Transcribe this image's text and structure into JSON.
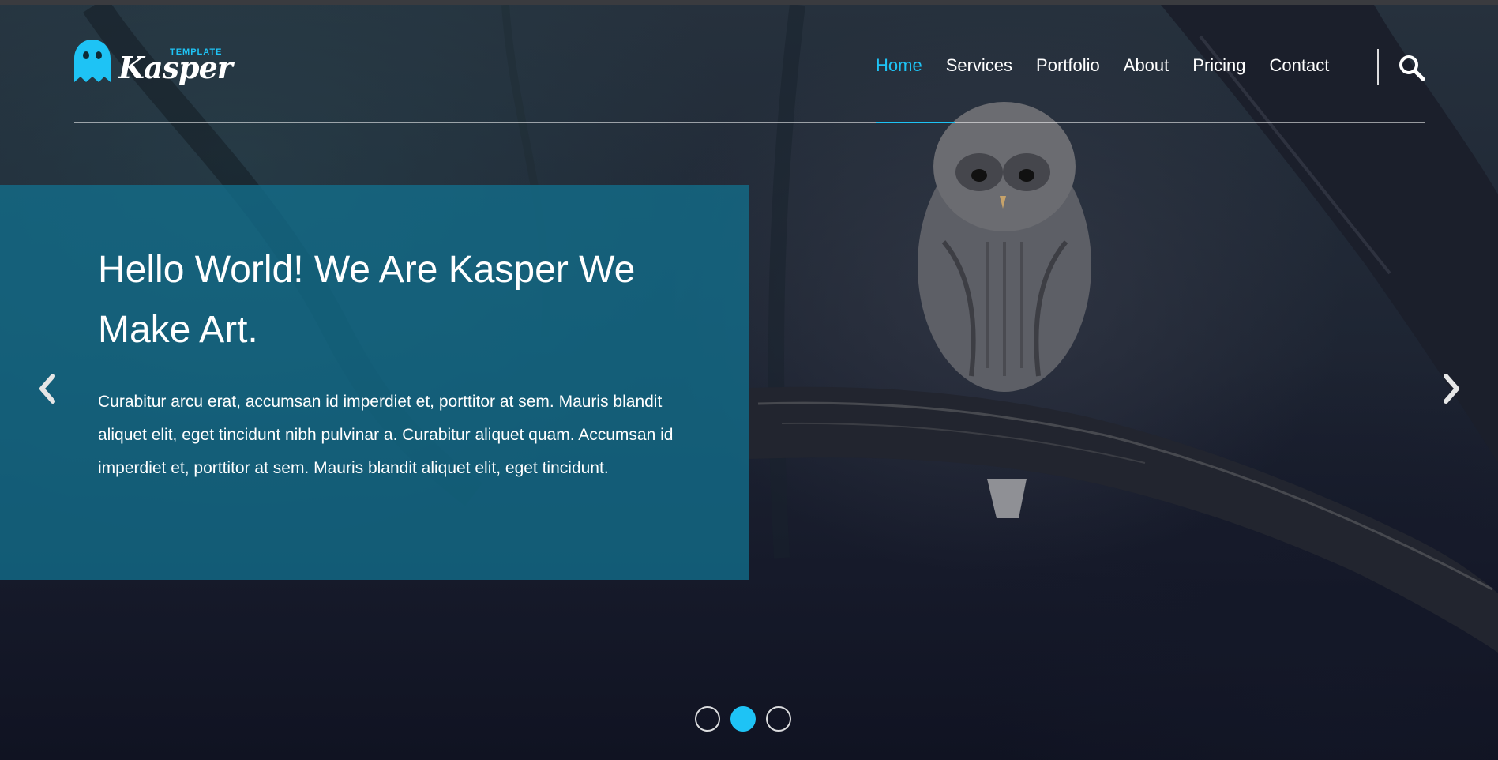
{
  "header": {
    "logo": {
      "tag": "TEMPLATE",
      "wordmark": "Kasper",
      "icon": "ghost-icon"
    },
    "nav": [
      {
        "label": "Home",
        "active": true
      },
      {
        "label": "Services",
        "active": false
      },
      {
        "label": "Portfolio",
        "active": false
      },
      {
        "label": "About",
        "active": false
      },
      {
        "label": "Pricing",
        "active": false
      },
      {
        "label": "Contact",
        "active": false
      }
    ],
    "search_icon": "search-icon"
  },
  "hero": {
    "headline": "Hello World! We Are Kasper We Make Art.",
    "body": "Curabitur arcu erat, accumsan id imperdiet et, porttitor at sem. Mauris blandit aliquet elit, eget tincidunt nibh pulvinar a. Curabitur aliquet quam. Accumsan id imperdiet et, porttitor at sem. Mauris blandit aliquet elit, eget tincidunt.",
    "prev_icon": "chevron-left-icon",
    "next_icon": "chevron-right-icon",
    "slides": {
      "count": 3,
      "active_index": 1
    }
  },
  "colors": {
    "accent": "#1ec3f5",
    "overlay": "#126e8c",
    "text": "#ffffff"
  }
}
